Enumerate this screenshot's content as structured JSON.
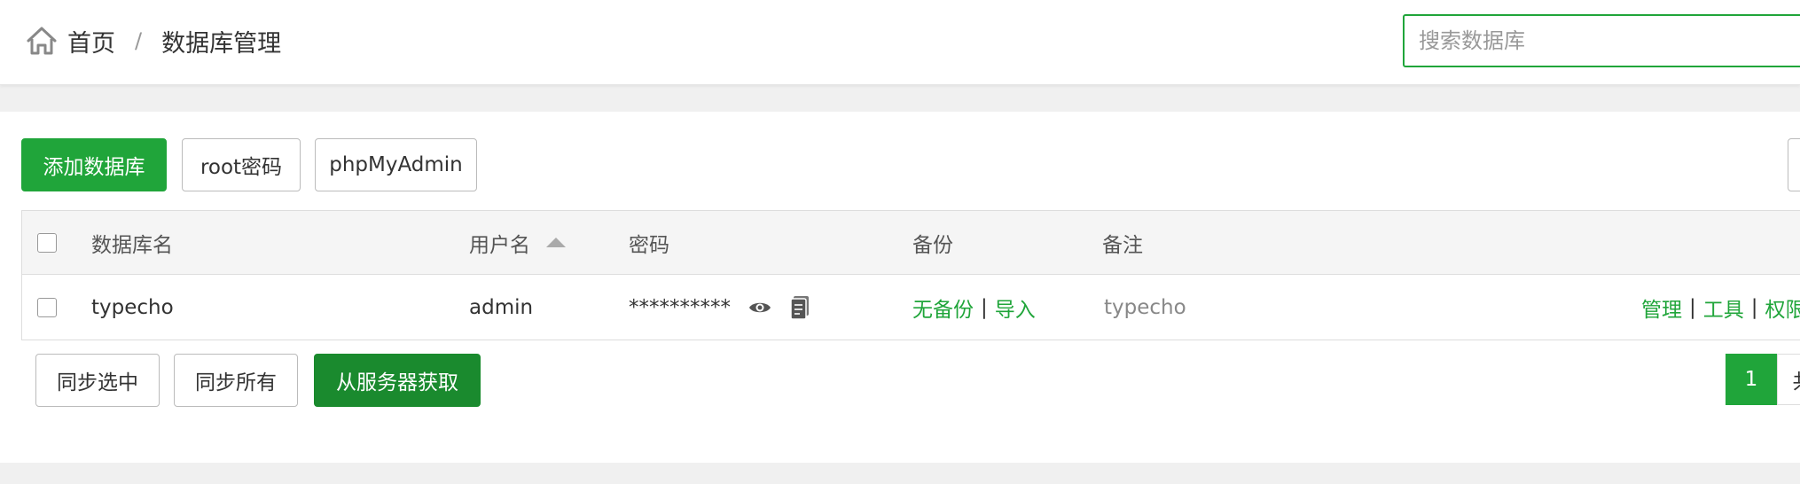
{
  "breadcrumb": {
    "home_label": "首页",
    "separator": "/",
    "current_label": "数据库管理"
  },
  "search": {
    "placeholder": "搜索数据库"
  },
  "toolbar": {
    "add_db_label": "添加数据库",
    "root_password_label": "root密码",
    "phpmyadmin_label": "phpMyAdmin"
  },
  "table": {
    "headers": {
      "name": "数据库名",
      "user": "用户名",
      "password": "密码",
      "backup": "备份",
      "note": "备注"
    },
    "rows": [
      {
        "name": "typecho",
        "user": "admin",
        "password": "**********",
        "backup_status": "无备份",
        "import": "导入",
        "note": "typecho",
        "actions": [
          "管理",
          "工具",
          "权限"
        ]
      }
    ]
  },
  "footer_buttons": {
    "sync_selected": "同步选中",
    "sync_all": "同步所有",
    "fetch_from_server": "从服务器获取"
  },
  "pagination": {
    "current_page": "1",
    "next_partial": "共"
  },
  "colors": {
    "accent": "#20a53a",
    "accent_dark": "#1a8a2e",
    "border": "#dddddd"
  }
}
